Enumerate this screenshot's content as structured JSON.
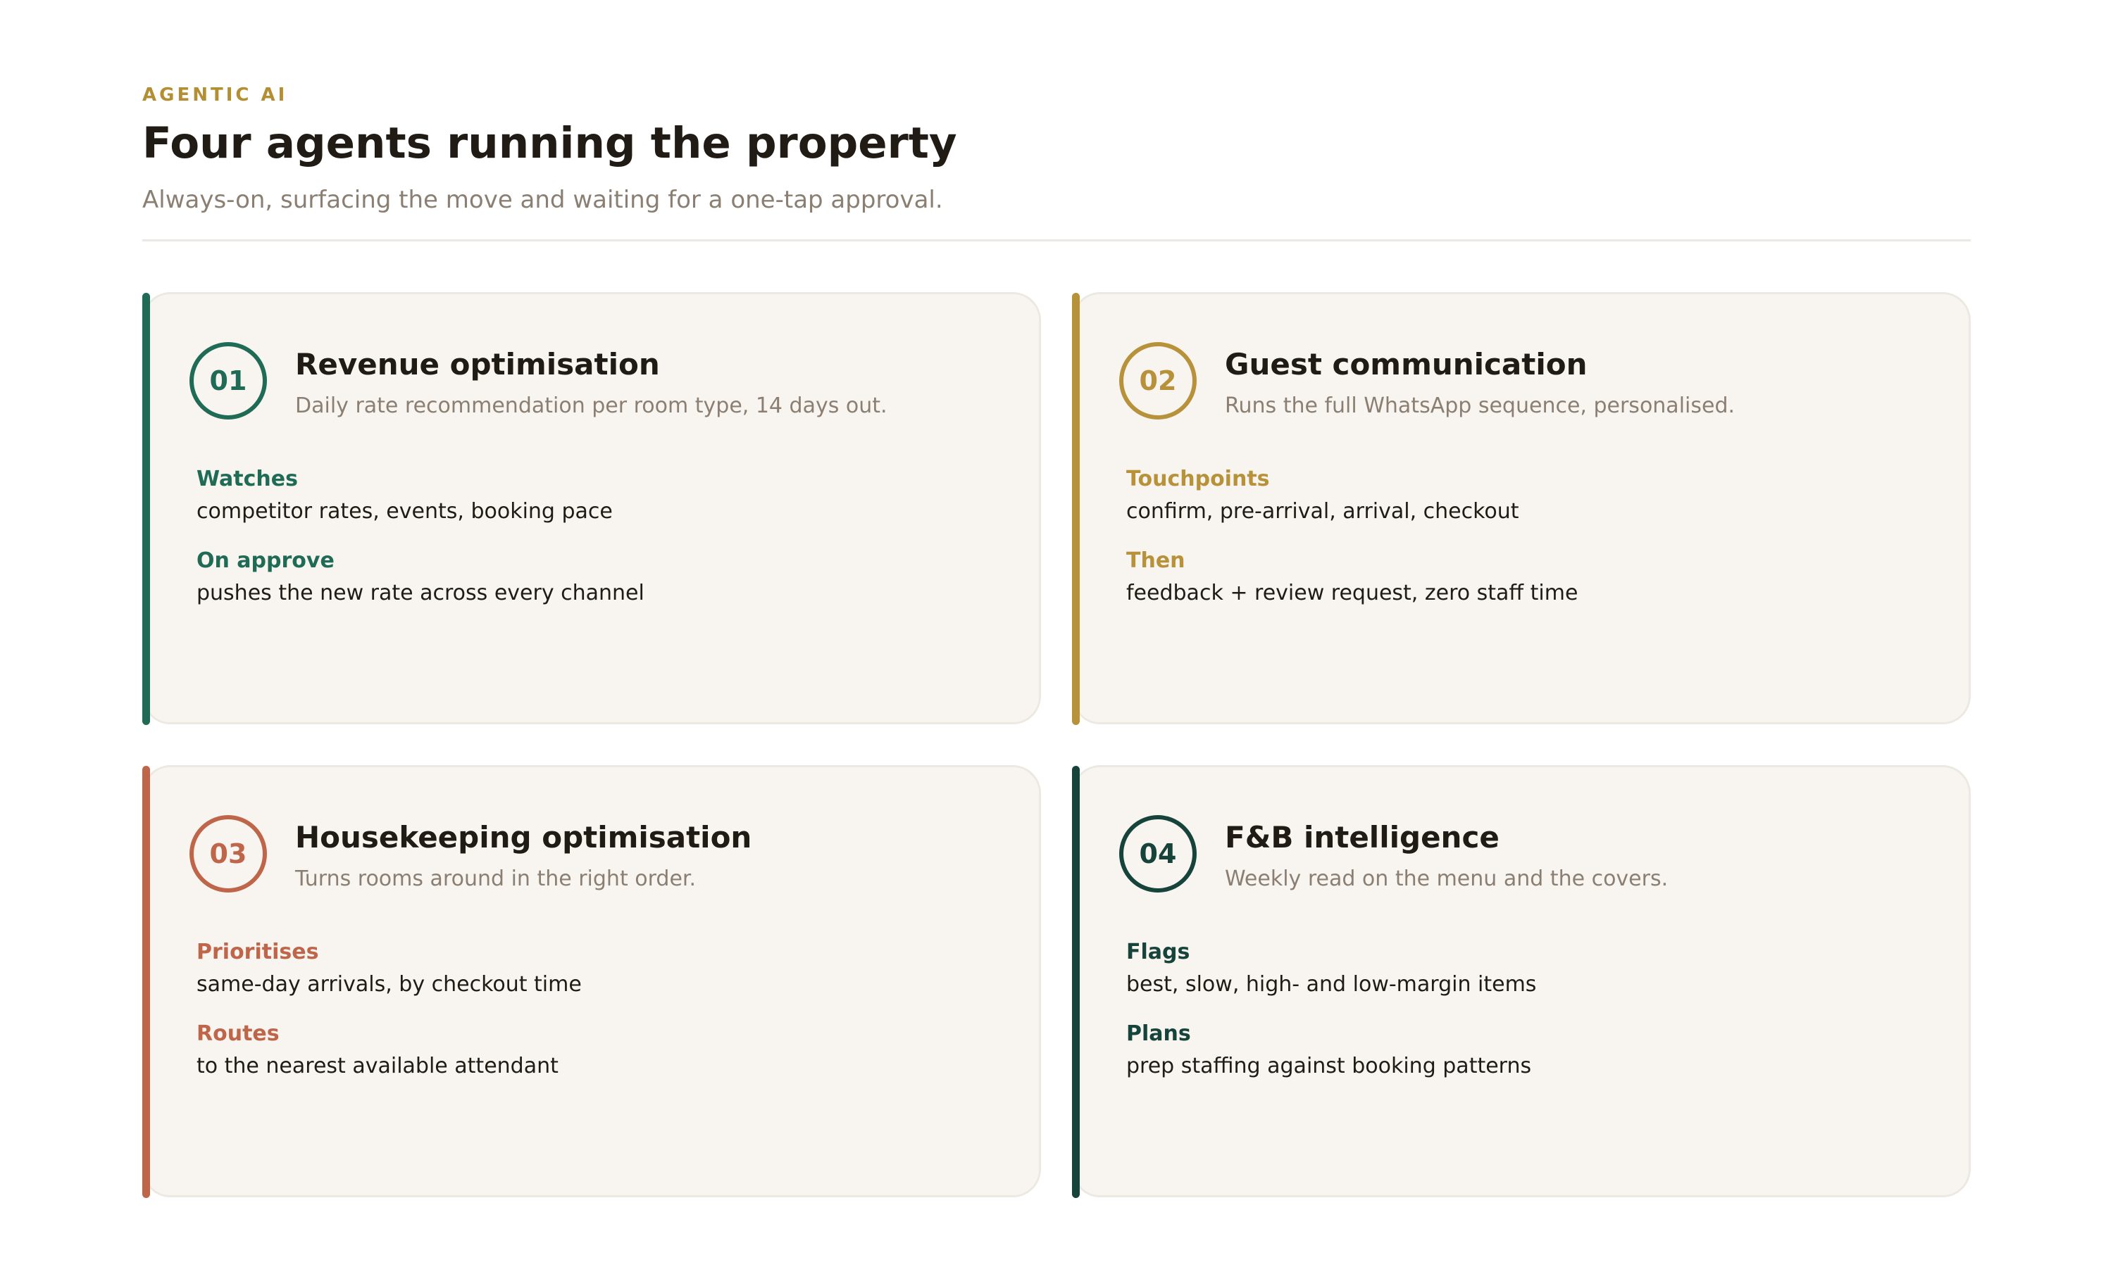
{
  "header": {
    "eyebrow": "AGENTIC AI",
    "title": "Four agents running the property",
    "subtitle": "Always-on, surfacing the move and waiting for a one-tap approval."
  },
  "agents": [
    {
      "number": "01",
      "title": "Revenue optimisation",
      "subtitle": "Daily rate recommendation per room type, 14 days out.",
      "accent": "#1f6b55",
      "fields": [
        {
          "label": "Watches",
          "value": "competitor rates, events, booking pace"
        },
        {
          "label": "On approve",
          "value": "pushes the new rate across every channel"
        }
      ]
    },
    {
      "number": "02",
      "title": "Guest communication",
      "subtitle": "Runs the full WhatsApp sequence, personalised.",
      "accent": "#b8923a",
      "fields": [
        {
          "label": "Touchpoints",
          "value": "confirm, pre-arrival, arrival, checkout"
        },
        {
          "label": "Then",
          "value": "feedback + review request, zero staff time"
        }
      ]
    },
    {
      "number": "03",
      "title": "Housekeeping optimisation",
      "subtitle": "Turns rooms around in the right order.",
      "accent": "#bf654a",
      "fields": [
        {
          "label": "Prioritises",
          "value": "same-day arrivals, by checkout time"
        },
        {
          "label": "Routes",
          "value": "to the nearest available attendant"
        }
      ]
    },
    {
      "number": "04",
      "title": "F&B intelligence",
      "subtitle": "Weekly read on the menu and the covers.",
      "accent": "#17443a",
      "fields": [
        {
          "label": "Flags",
          "value": "best, slow, high- and low-margin items"
        },
        {
          "label": "Plans",
          "value": "prep staffing against booking patterns"
        }
      ]
    }
  ]
}
